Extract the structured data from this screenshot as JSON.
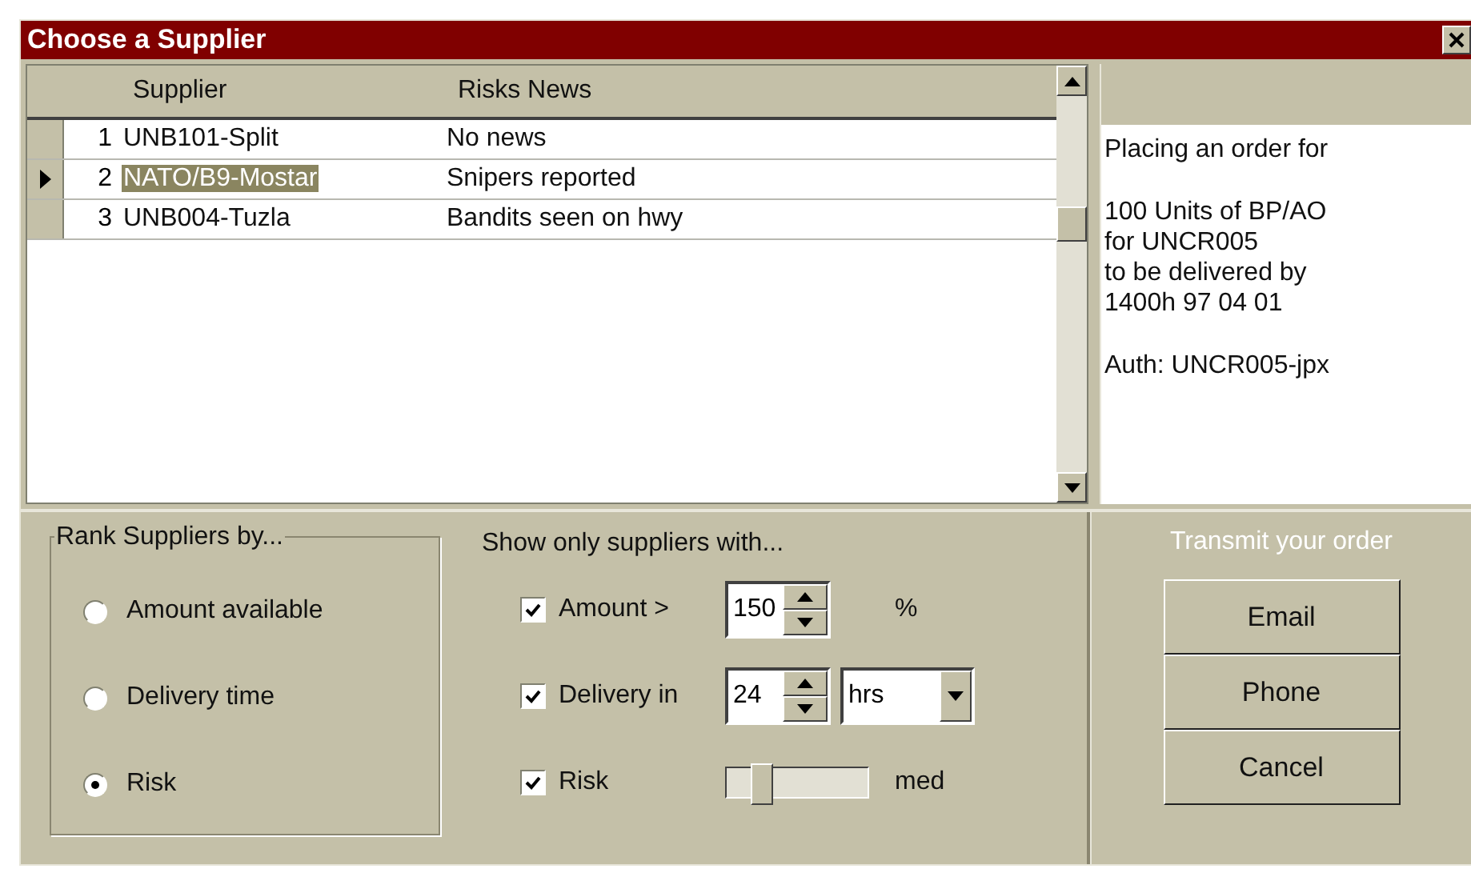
{
  "window": {
    "title": "Choose a Supplier"
  },
  "table": {
    "columns": [
      "Supplier",
      "Risks News"
    ],
    "rows": [
      {
        "number": "1",
        "supplier": "UNB101-Split",
        "news": "No news",
        "selected": false
      },
      {
        "number": "2",
        "supplier": "NATO/B9-Mostar",
        "news": "Snipers reported",
        "selected": true
      },
      {
        "number": "3",
        "supplier": "UNB004-Tuzla",
        "news": "Bandits seen on hwy",
        "selected": false
      }
    ]
  },
  "order_summary": {
    "paragraphs": [
      "Placing an order for",
      "100 Units of BP/AO\nfor UNCR005\nto be delivered by\n1400h 97 04 01",
      "Auth: UNCR005-jpx"
    ]
  },
  "rank": {
    "title": "Rank Suppliers by...",
    "options": [
      {
        "label": "Amount available",
        "selected": false
      },
      {
        "label": "Delivery time",
        "selected": false
      },
      {
        "label": "Risk",
        "selected": true
      }
    ]
  },
  "filters": {
    "title": "Show only suppliers with...",
    "items": [
      {
        "kind": "spin",
        "label": "Amount >",
        "checked": true,
        "value": "150",
        "unit": "%"
      },
      {
        "kind": "spin_select",
        "label": "Delivery in",
        "checked": true,
        "value": "24",
        "select_value": "hrs"
      },
      {
        "kind": "slider",
        "label": "Risk",
        "checked": true,
        "level": 0.25,
        "reading": "med"
      }
    ]
  },
  "transmit": {
    "title": "Transmit your order",
    "buttons": [
      "Email",
      "Phone",
      "Cancel"
    ]
  }
}
